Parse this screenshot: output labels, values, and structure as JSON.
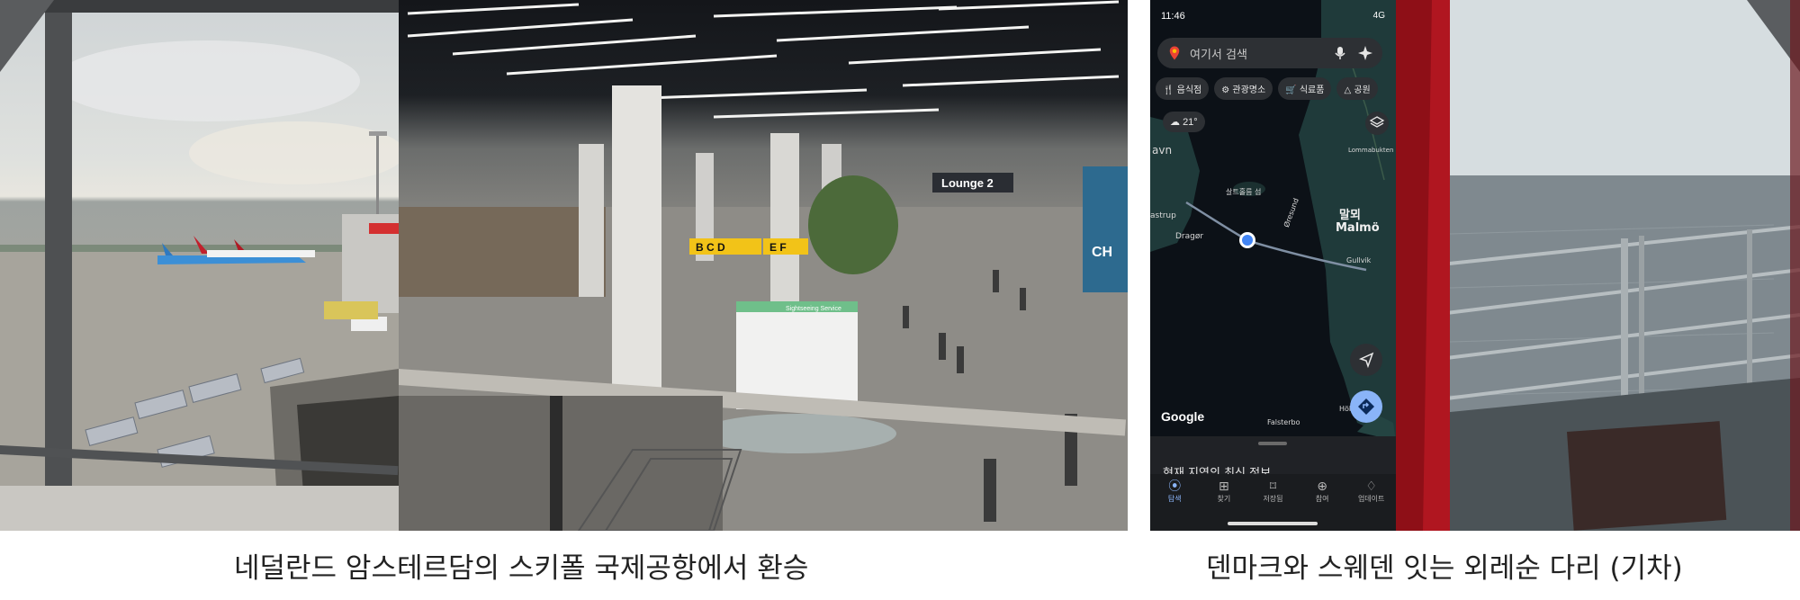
{
  "captions": {
    "left": "네덜란드 암스테르담의 스키폴 국제공항에서 환승",
    "right": "덴마크와 스웨덴 잇는 외레순 다리 (기차)"
  },
  "photo2": {
    "lounge_sign": "Lounge 2",
    "gate_sign": "B C D",
    "gate_sign2": "E F",
    "shop_sign": "Sightseeing Service",
    "ad_text": "CH"
  },
  "phone": {
    "time": "11:46",
    "signal": "4G",
    "search_placeholder": "여기서 검색",
    "chips": [
      "음식점",
      "관광명소",
      "식료품",
      "공원"
    ],
    "weather": "21°",
    "map_labels": {
      "malmo_kr": "말뫼",
      "malmo": "Malmö",
      "saltholm": "살트홀름 섬",
      "dragor": "Dragør",
      "kastrup": "astrup",
      "havn": "avn",
      "gullvik": "Gullvik",
      "falsterbo": "Falsterbo",
      "lommabukten": "Lommabukten",
      "oresund": "Øresund",
      "holviken": "Höllv"
    },
    "google": "Google",
    "sheet_title": "현재 지역의 최신 정보",
    "tabs": [
      "탐색",
      "찾기",
      "저장됨",
      "참여",
      "업데이트"
    ]
  }
}
